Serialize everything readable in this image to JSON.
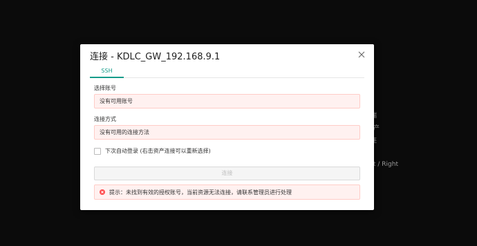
{
  "background": {
    "fragments": [
      "端",
      "产",
      "连",
      "t / Right"
    ]
  },
  "modal": {
    "title": "连接 - KDLC_GW_192.168.9.1",
    "tabs": [
      {
        "label": "SSH"
      }
    ],
    "account_label": "选择账号",
    "account_value": "没有可用账号",
    "method_label": "连接方式",
    "method_value": "没有可用的连接方法",
    "auto_login_label": "下次自动登录 (右击资产连接可以重新选择)",
    "connect_button": "连接",
    "alert_text": "提示：未找到有效的授权账号，当前资源无法连接，请联系管理员进行处理"
  },
  "colors": {
    "accent": "#169c8a",
    "error": "#ff4d4f",
    "error_bg": "#fff1f0",
    "error_border": "#ffccc7"
  },
  "icons": [
    "close-icon",
    "error-icon"
  ]
}
